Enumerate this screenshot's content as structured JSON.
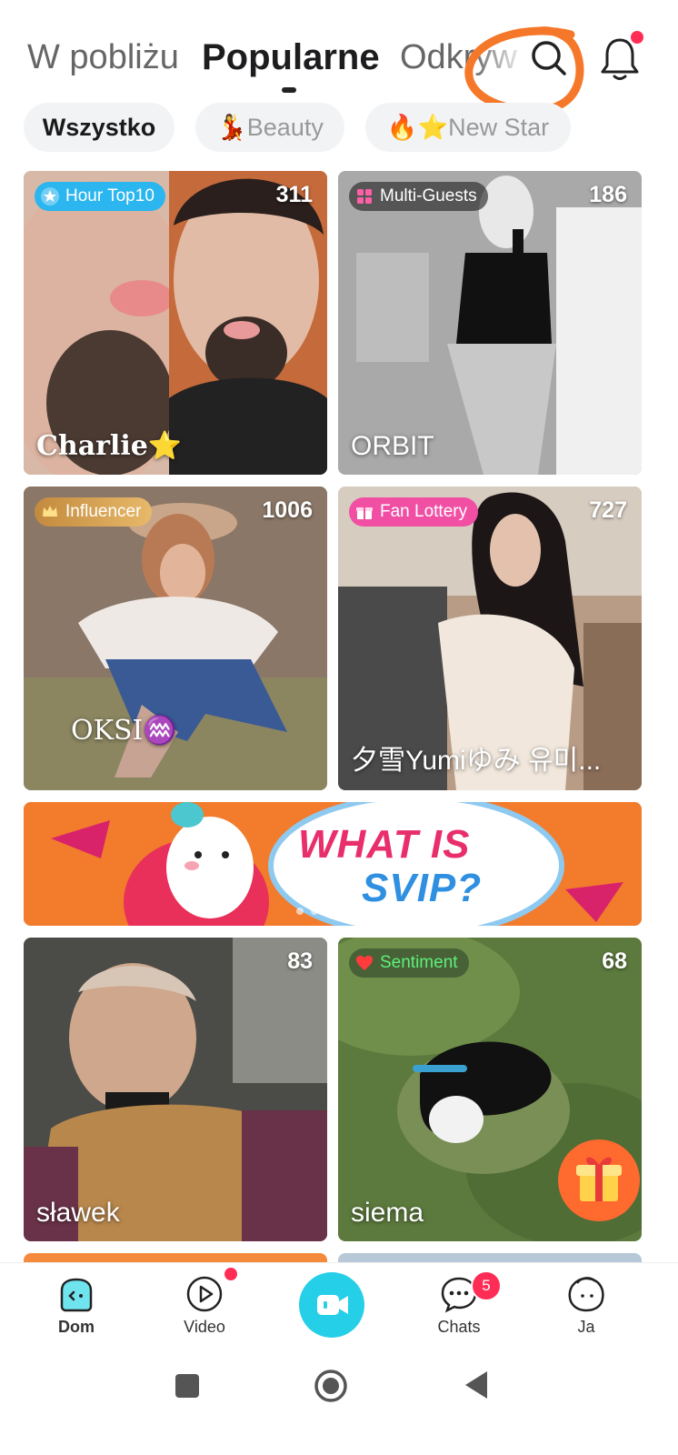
{
  "header": {
    "tabs": [
      {
        "label": "W pobliżu",
        "active": false
      },
      {
        "label": "Popularne",
        "active": true
      },
      {
        "label": "Odkryw",
        "active": false
      }
    ]
  },
  "filters": [
    {
      "label": "Wszystko",
      "active": true
    },
    {
      "label": "💃Beauty",
      "active": false
    },
    {
      "label": "🔥⭐New Star",
      "active": false
    }
  ],
  "streams": [
    {
      "badge": "Hour Top10",
      "viewers": "311",
      "name": "Charlie⭐"
    },
    {
      "badge": "Multi-Guests",
      "viewers": "186",
      "name": "ORBIT"
    },
    {
      "badge": "Influencer",
      "viewers": "1006",
      "name": "OKSI♒"
    },
    {
      "badge": "Fan Lottery",
      "viewers": "727",
      "name": "夕雪Yumiゆみ 유미..."
    },
    {
      "badge": "",
      "viewers": "83",
      "name": "sławek"
    },
    {
      "badge": "Sentiment",
      "viewers": "68",
      "name": "siema"
    }
  ],
  "banner": {
    "line1": "WHAT IS",
    "line2": "SVIP?",
    "slide_count": 5,
    "active_slide": 4
  },
  "bottom_nav": {
    "items": [
      {
        "label": "Dom",
        "icon": "home-icon",
        "active": true
      },
      {
        "label": "Video",
        "icon": "play-icon",
        "active": false
      },
      {
        "label": "",
        "icon": "go-live-icon",
        "active": false
      },
      {
        "label": "Chats",
        "icon": "chat-icon",
        "active": false
      },
      {
        "label": "Ja",
        "icon": "profile-icon",
        "active": false
      }
    ],
    "chats_badge": "5"
  },
  "colors": {
    "accent": "#26cfe8",
    "notification": "#ff2d55",
    "annotation": "#f5782a"
  }
}
